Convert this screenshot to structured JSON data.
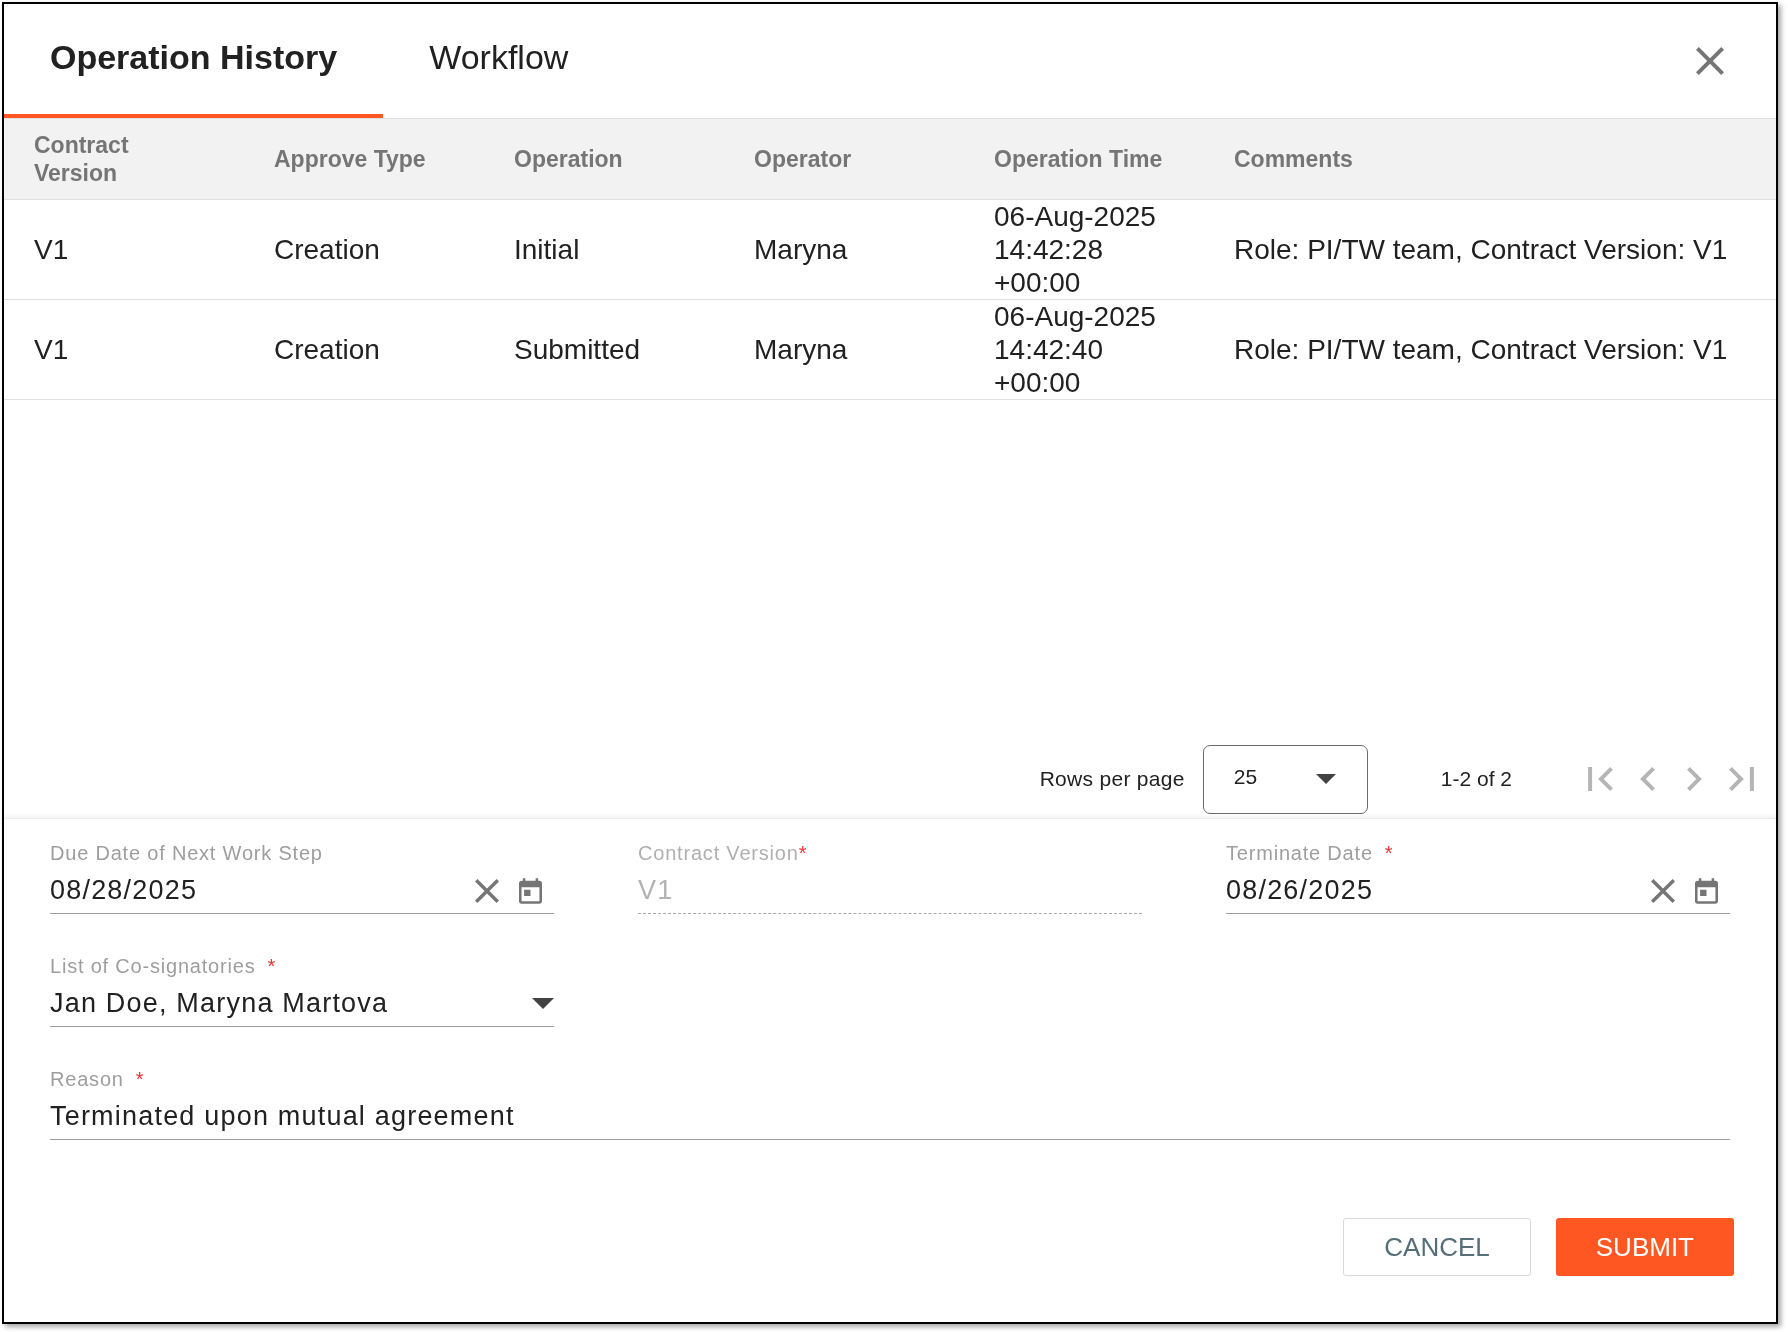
{
  "dialog": {
    "tabs": [
      {
        "label": "Operation History",
        "selected": true
      },
      {
        "label": "Workflow",
        "selected": false
      }
    ]
  },
  "table": {
    "columns": [
      "Contract Version",
      "Approve Type",
      "Operation",
      "Operator",
      "Operation Time",
      "Comments"
    ],
    "rows": [
      {
        "cells": [
          "V1",
          "Creation",
          "Initial",
          "Maryna",
          "06-Aug-2025 14:42:28 +00:00",
          "Role: PI/TW team, Contract Version: V1"
        ]
      },
      {
        "cells": [
          "V1",
          "Creation",
          "Submitted",
          "Maryna",
          "06-Aug-2025 14:42:40 +00:00",
          "Role: PI/TW team, Contract Version: V1"
        ]
      }
    ]
  },
  "pagination": {
    "rows_per_page_label": "Rows per page",
    "rows_per_page": "25",
    "range": "1-2 of 2",
    "nav": [
      {
        "kind": "first",
        "disabled": true
      },
      {
        "kind": "previous",
        "disabled": true
      },
      {
        "kind": "next",
        "disabled": true
      },
      {
        "kind": "last",
        "disabled": true
      }
    ]
  },
  "form": {
    "fields": [
      {
        "kind": "date",
        "label": "Due Date of Next Work Step",
        "value": "08/28/2025",
        "disabled": false,
        "full_width": false
      },
      {
        "kind": "text",
        "label": "Contract Version",
        "required_mark": "*",
        "value": "V1",
        "disabled": true,
        "full_width": false
      },
      {
        "kind": "date",
        "label": "Terminate Date",
        "required_mark": "*",
        "value": "08/26/2025",
        "disabled": false,
        "full_width": false
      },
      {
        "kind": "select",
        "label": "List of Co-signatories",
        "required_mark": "*",
        "value": "Jan Doe, Maryna Martova",
        "disabled": false,
        "full_width": false
      },
      {
        "kind": "text",
        "label": "Reason",
        "required_mark": "*",
        "value": "Terminated upon mutual agreement",
        "disabled": false,
        "full_width": true
      }
    ]
  },
  "buttons": [
    {
      "kind": "secondary",
      "label": "CANCEL"
    },
    {
      "kind": "primary",
      "label": "SUBMIT"
    }
  ]
}
